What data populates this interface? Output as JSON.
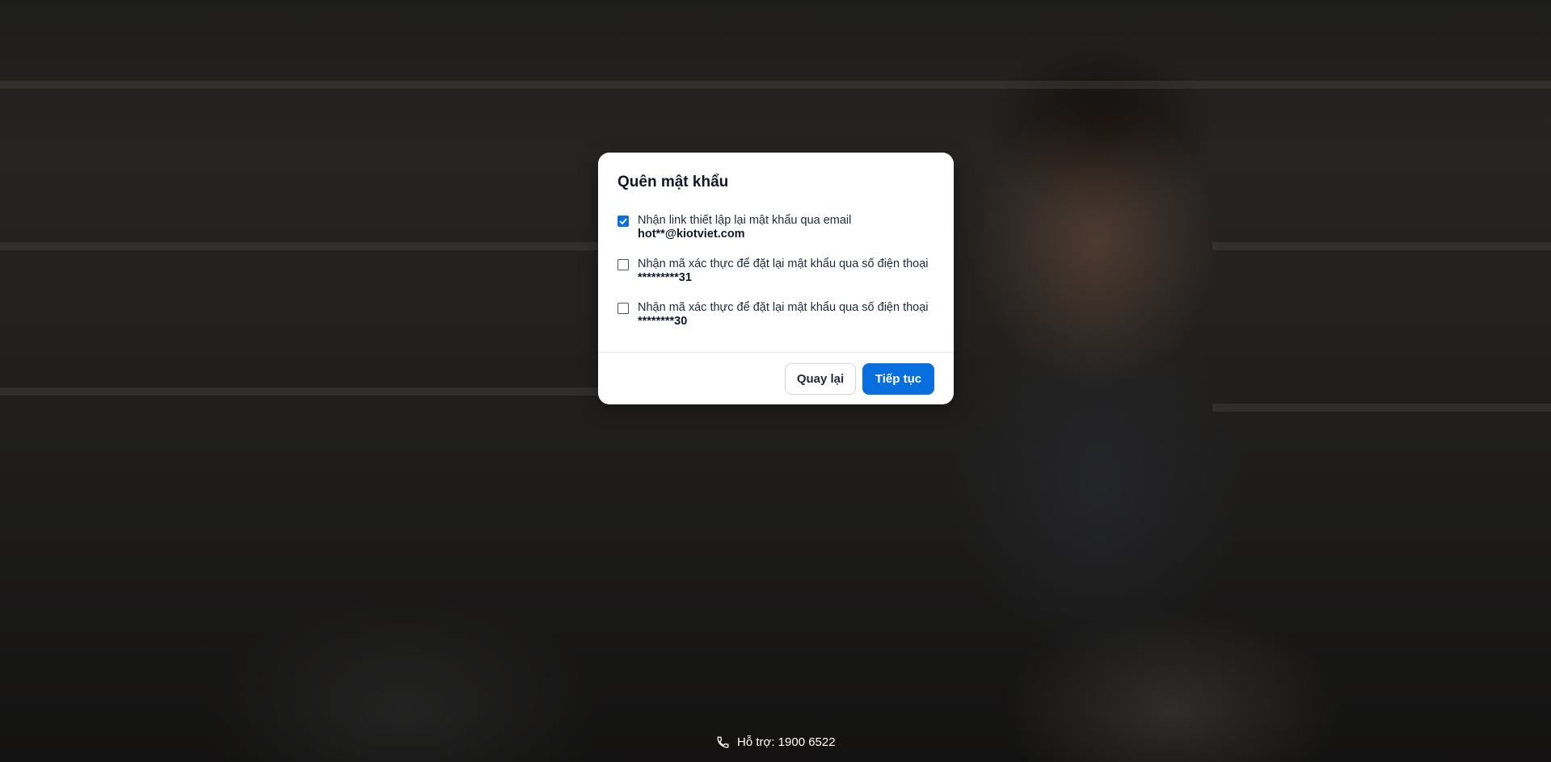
{
  "modal": {
    "title": "Quên mật khẩu",
    "options": [
      {
        "label": "Nhận link thiết lập lại mật khẩu qua email",
        "value": "hot**@kiotviet.com",
        "checked": true
      },
      {
        "label": "Nhận mã xác thực để đặt lại mật khẩu qua số điện thoại",
        "value": "*********31",
        "checked": false
      },
      {
        "label": "Nhận mã xác thực để đặt lại mật khẩu qua số điện thoại",
        "value": "********30",
        "checked": false
      }
    ],
    "back_label": "Quay lại",
    "continue_label": "Tiếp tục"
  },
  "footer": {
    "support_text": "Hỗ trợ: 1900 6522",
    "support_icon": "phone-icon"
  },
  "colors": {
    "accent": "#0a6fde",
    "modal_bg": "#ffffff"
  }
}
